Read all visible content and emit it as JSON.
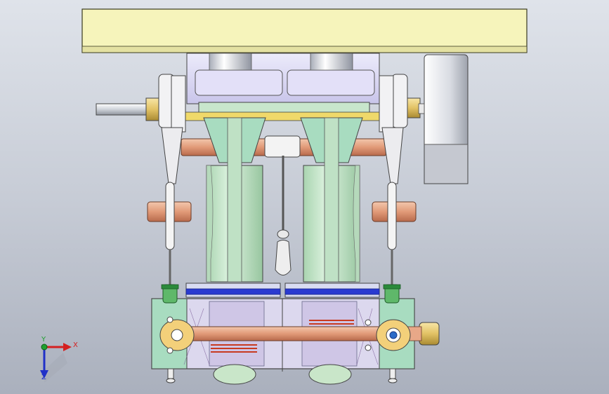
{
  "app": {
    "view": "engine-assembly-front-view"
  },
  "triad": {
    "x_label": "X",
    "y_label": "Y",
    "z_label": "Z",
    "x_color": "#d42020",
    "y_color": "#20a030",
    "z_color": "#2030c8"
  },
  "colors": {
    "background_top": "#dfe3ea",
    "background_bottom": "#aab0bd",
    "frame_yellow": "#f6f4bb",
    "block_lavender": "#dcd8f4",
    "column_green": "#c8e6cc",
    "bracket_green": "#a8dcc0",
    "pipe_copper": "#e8a888",
    "brass": "#e2c265",
    "piston_blue": "#2a3ad0",
    "valve_green": "#2a8a3a"
  },
  "icons": [
    "coordinate-triad-icon"
  ]
}
